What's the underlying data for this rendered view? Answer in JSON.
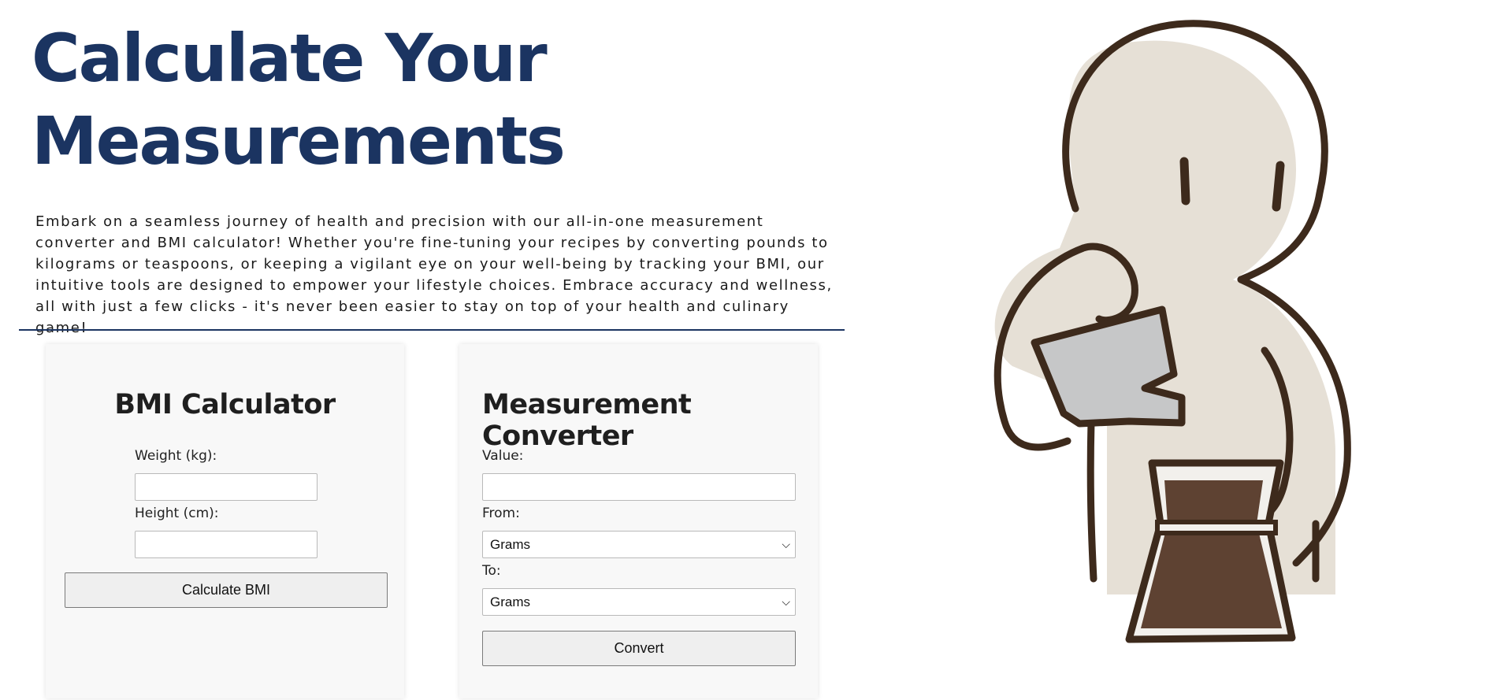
{
  "hero": {
    "title_line1": "Calculate Your",
    "title_line2": "Measurements",
    "intro": "Embark on a seamless journey of health and precision with our all-in-one measurement converter and BMI calculator! Whether you're fine-tuning your recipes by converting pounds to kilograms or teaspoons, or keeping a vigilant eye on your well-being by tracking your BMI, our intuitive tools are designed to empower your lifestyle choices. Embrace accuracy and wellness, all with just a few clicks - it's never been easier to stay on top of your health and culinary game!"
  },
  "bmi": {
    "title": "BMI Calculator",
    "weight_label": "Weight (kg):",
    "weight_value": "",
    "height_label": "Height (cm):",
    "height_value": "",
    "button_label": "Calculate BMI"
  },
  "converter": {
    "title": "Measurement Converter",
    "value_label": "Value:",
    "value_value": "",
    "from_label": "From:",
    "from_selected": "Grams",
    "to_label": "To:",
    "to_selected": "Grams",
    "button_label": "Convert"
  },
  "illustration": {
    "subject": "person-pouring-coffee-illustration",
    "colors": {
      "outline": "#3d2a1c",
      "body": "#e6e0d6",
      "kettle": "#c6c7c8",
      "coffee": "#5e4232"
    }
  }
}
